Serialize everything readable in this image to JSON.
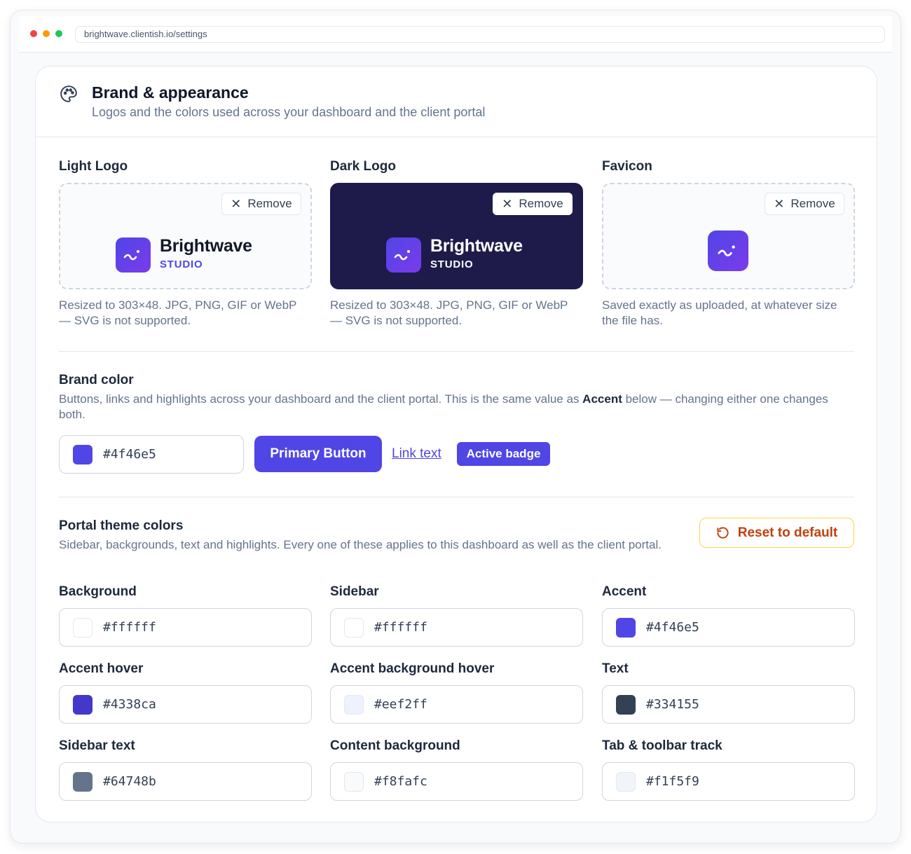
{
  "browser": {
    "url": "brightwave.clientish.io/settings"
  },
  "header": {
    "title": "Brand & appearance",
    "subtitle": "Logos and the colors used across your dashboard and the client portal",
    "icon": "palette-icon"
  },
  "logos": {
    "light": {
      "label": "Light Logo",
      "remove_label": "Remove",
      "brand_name": "Brightwave",
      "brand_tag": "STUDIO",
      "help": "Resized to 303×48. JPG, PNG, GIF or WebP — SVG is not supported."
    },
    "dark": {
      "label": "Dark Logo",
      "remove_label": "Remove",
      "brand_name": "Brightwave",
      "brand_tag": "STUDIO",
      "help": "Resized to 303×48. JPG, PNG, GIF or WebP — SVG is not supported."
    },
    "favicon": {
      "label": "Favicon",
      "remove_label": "Remove",
      "help": "Saved exactly as uploaded, at whatever size the file has."
    }
  },
  "brand_color": {
    "title": "Brand color",
    "description_before": "Buttons, links and highlights across your dashboard and the client portal. This is the same value as ",
    "description_bold": "Accent",
    "description_after": " below — changing either one changes both.",
    "value": "#4f46e5",
    "preview": {
      "primary_button": "Primary Button",
      "link_text": "Link text",
      "active_badge": "Active badge"
    }
  },
  "portal_theme": {
    "title": "Portal theme colors",
    "description": "Sidebar, backgrounds, text and highlights. Every one of these applies to this dashboard as well as the client portal.",
    "reset_label": "Reset to default",
    "colors": [
      {
        "label": "Background",
        "value": "#ffffff"
      },
      {
        "label": "Sidebar",
        "value": "#ffffff"
      },
      {
        "label": "Accent",
        "value": "#4f46e5"
      },
      {
        "label": "Accent hover",
        "value": "#4338ca"
      },
      {
        "label": "Accent background hover",
        "value": "#eef2ff"
      },
      {
        "label": "Text",
        "value": "#334155"
      },
      {
        "label": "Sidebar text",
        "value": "#64748b"
      },
      {
        "label": "Content background",
        "value": "#f8fafc"
      },
      {
        "label": "Tab & toolbar track",
        "value": "#f1f5f9"
      }
    ]
  }
}
